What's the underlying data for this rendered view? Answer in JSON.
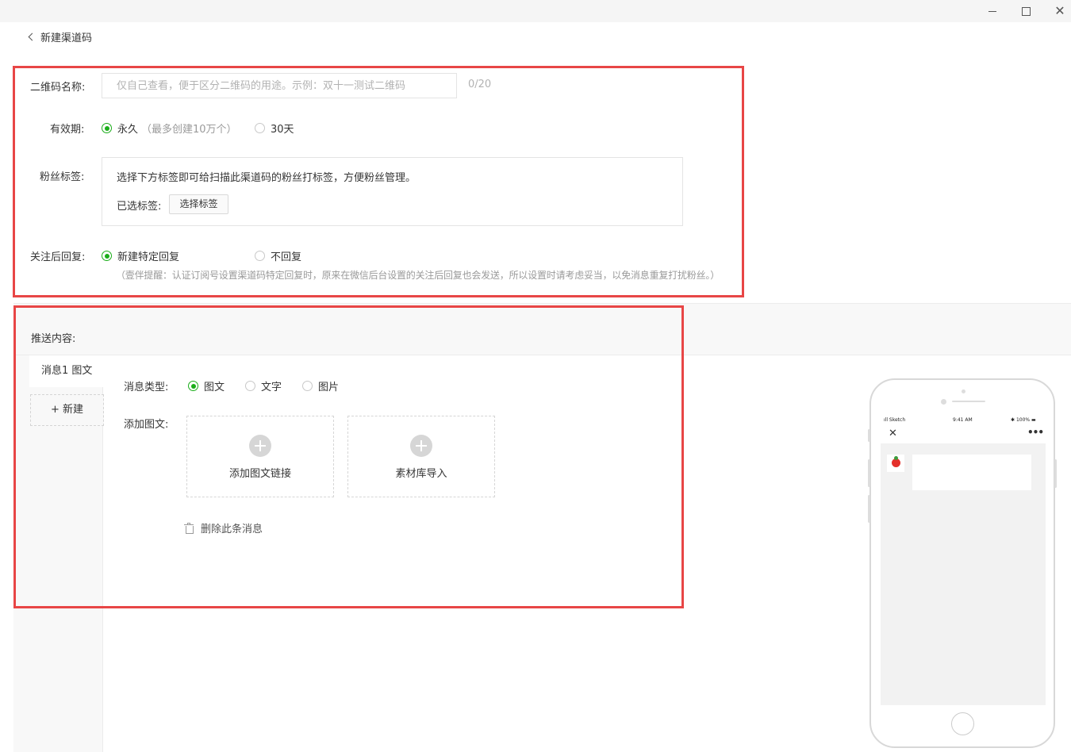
{
  "window": {
    "minimize_label": "–",
    "maximize_label": "□",
    "close_label": "✕"
  },
  "header": {
    "back_label": "新建渠道码"
  },
  "form": {
    "name": {
      "label": "二维码名称:",
      "placeholder": "仅自己查看，便于区分二维码的用途。示例：双十一测试二维码",
      "value": "",
      "counter": "0/20"
    },
    "validity": {
      "label": "有效期:",
      "options": [
        {
          "label": "永久",
          "hint": "（最多创建10万个）",
          "selected": true
        },
        {
          "label": "30天",
          "hint": "",
          "selected": false
        }
      ]
    },
    "tags": {
      "label": "粉丝标签:",
      "description": "选择下方标签即可给扫描此渠道码的粉丝打标签，方便粉丝管理。",
      "selected_label": "已选标签:",
      "select_button": "选择标签"
    },
    "reply": {
      "label": "关注后回复:",
      "options": [
        {
          "label": "新建特定回复",
          "selected": true
        },
        {
          "label": "不回复",
          "selected": false
        }
      ],
      "tip": "（壹伴提醒：认证订阅号设置渠道码特定回复时，原来在微信后台设置的关注后回复也会发送，所以设置时请考虑妥当，以免消息重复打扰粉丝。）"
    }
  },
  "push": {
    "title": "推送内容:",
    "messages": [
      {
        "label": "消息1 图文",
        "active": true
      }
    ],
    "new_button": "+ 新建",
    "msg_type": {
      "label": "消息类型:",
      "options": [
        {
          "label": "图文",
          "selected": true
        },
        {
          "label": "文字",
          "selected": false
        },
        {
          "label": "图片",
          "selected": false
        }
      ]
    },
    "add_article": {
      "label": "添加图文:",
      "link_card": "添加图文链接",
      "library_card": "素材库导入"
    },
    "delete_label": "删除此条消息"
  },
  "phone_preview": {
    "carrier": "Sketch",
    "time": "9:41 AM",
    "battery": "100%",
    "close_icon": "✕",
    "more_icon": "•••"
  },
  "colors": {
    "accent_green": "#1aad19",
    "highlight_red": "#e84646"
  }
}
